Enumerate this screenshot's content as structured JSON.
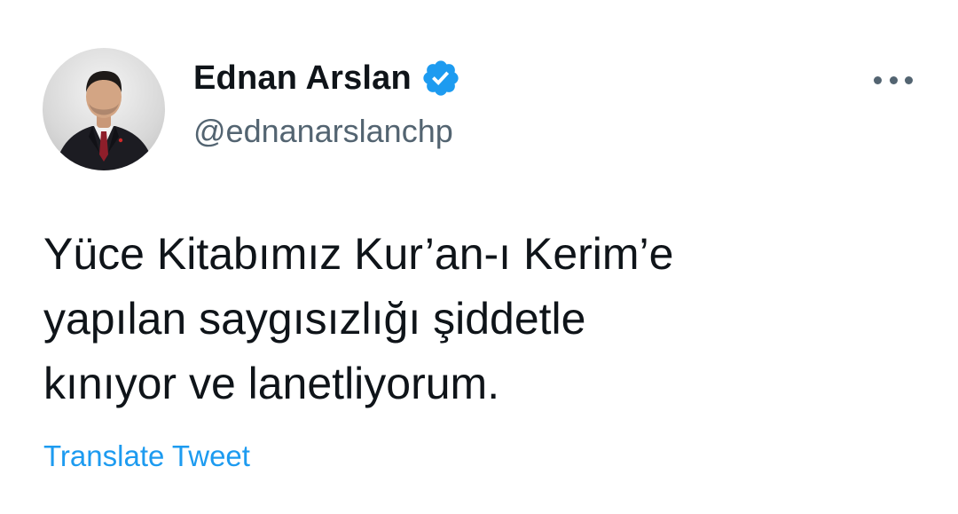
{
  "tweet": {
    "author": {
      "display_name": "Ednan Arslan",
      "handle": "@ednanarslanchp",
      "verified": true,
      "avatar_icon": "profile-photo"
    },
    "more_icon": "more-horizontal-icon",
    "text": "Yüce Kitabımız Kur’an-ı Kerim’e\nyapılan saygısızlığı şiddetle\nkınıyor ve lanetliyorum.",
    "translate_label": "Translate Tweet"
  },
  "colors": {
    "text": "#0f1419",
    "secondary": "#536471",
    "accent": "#1d9bf0"
  }
}
